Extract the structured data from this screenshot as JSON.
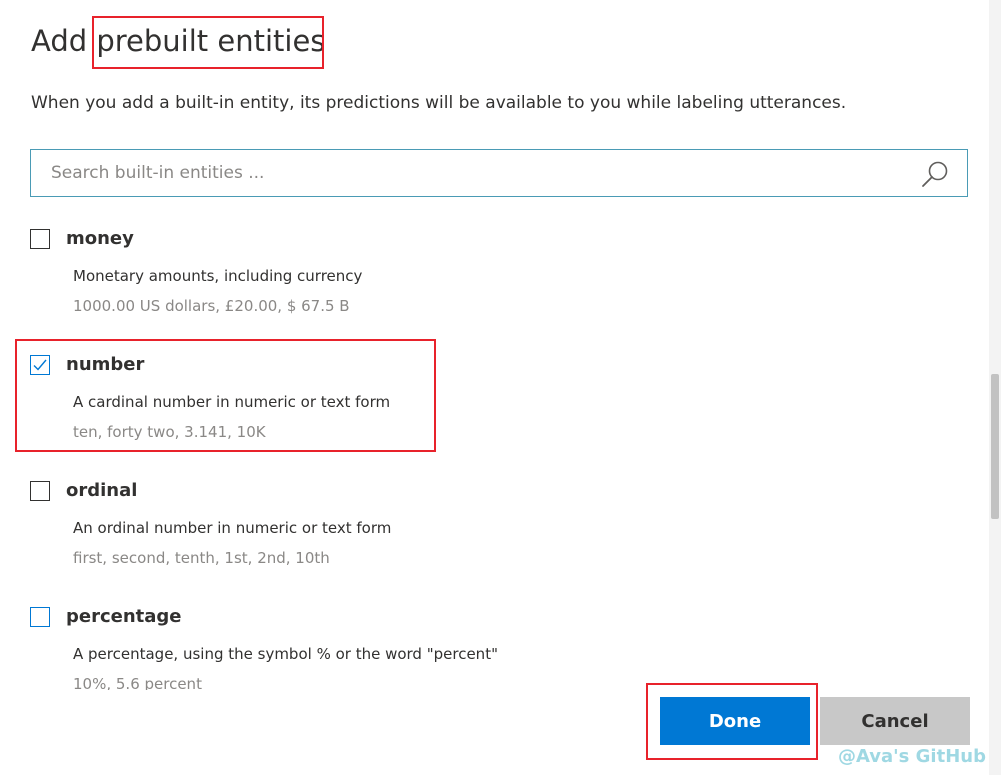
{
  "dialog": {
    "title": "Add prebuilt entities",
    "description": "When you add a built-in entity, its predictions will be available to you while labeling utterances."
  },
  "search": {
    "placeholder": "Search built-in entities ...",
    "value": "",
    "icon": "search-icon"
  },
  "entities": [
    {
      "name": "money",
      "description": "Monetary amounts, including currency",
      "examples": "1000.00 US dollars, £20.00, $ 67.5 B",
      "checked": false
    },
    {
      "name": "number",
      "description": "A cardinal number in numeric or text form",
      "examples": "ten, forty two, 3.141, 10K",
      "checked": true
    },
    {
      "name": "ordinal",
      "description": "An ordinal number in numeric or text form",
      "examples": "first, second, tenth, 1st, 2nd, 10th",
      "checked": false
    },
    {
      "name": "percentage",
      "description": "A percentage, using the symbol % or the word \"percent\"",
      "examples": "10%, 5.6 percent",
      "checked": false
    }
  ],
  "buttons": {
    "done": "Done",
    "cancel": "Cancel"
  },
  "watermark": "@Ava's GitHub",
  "colors": {
    "accent": "#0078d4",
    "annotation": "#e8222b",
    "cancel_bg": "#c8c8c8"
  }
}
